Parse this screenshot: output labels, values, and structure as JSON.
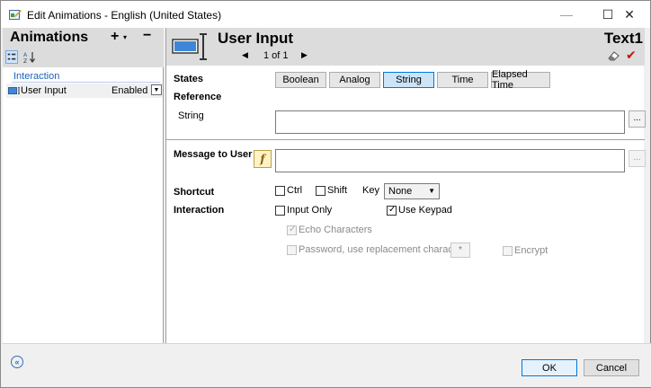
{
  "window": {
    "title": "Edit Animations - English (United States)",
    "minimize": "—",
    "maximize": "☐",
    "close": "✕"
  },
  "left_panel": {
    "title": "Animations",
    "add_label": "+",
    "add_caret": "▾",
    "remove_label": "−",
    "sort_az_icon": "sort-az-icon",
    "group": "Interaction",
    "items": [
      {
        "label": "User Input",
        "value": "Enabled"
      }
    ]
  },
  "right_panel": {
    "object_name": "User Input",
    "target_name": "Text1",
    "pager": {
      "text": "1 of 1",
      "prev": "◀",
      "next": "▶"
    },
    "states": {
      "label": "States",
      "options": [
        "Boolean",
        "Analog",
        "String",
        "Time",
        "Elapsed Time"
      ],
      "selected": "String"
    },
    "reference": {
      "label": "Reference",
      "sub_label": "String",
      "value": "",
      "browse": "..."
    },
    "message": {
      "label": "Message to User",
      "fx_label": "f",
      "value": "",
      "browse": "..."
    },
    "shortcut": {
      "label": "Shortcut",
      "ctrl": {
        "label": "Ctrl",
        "checked": false
      },
      "shift": {
        "label": "Shift",
        "checked": false
      },
      "key_label": "Key",
      "key_value": "None"
    },
    "interaction": {
      "label": "Interaction",
      "input_only": {
        "label": "Input Only",
        "checked": false
      },
      "use_keypad": {
        "label": "Use Keypad",
        "checked": true
      },
      "echo_characters": {
        "label": "Echo Characters",
        "checked": true,
        "disabled": true
      },
      "password": {
        "label": "Password, use replacement character",
        "checked": false,
        "disabled": true,
        "char": "*"
      },
      "encrypt": {
        "label": "Encrypt",
        "checked": false,
        "disabled": true
      }
    }
  },
  "footer": {
    "collapse_label": "«",
    "ok_label": "OK",
    "cancel_label": "Cancel"
  },
  "colors": {
    "accent": "#0078d7",
    "header_bg": "#dcdcdc",
    "group_text": "#1e63b8",
    "check_red": "#c41212"
  }
}
